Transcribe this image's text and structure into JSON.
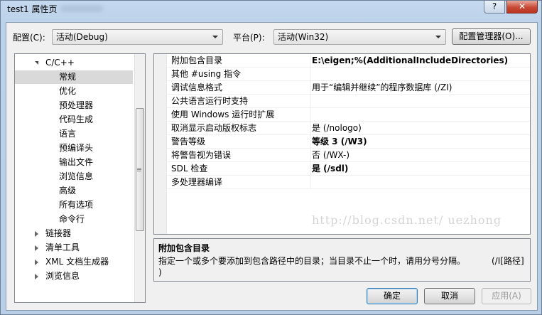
{
  "window": {
    "title": "test1 属性页",
    "help_label": "?",
    "close_label": "✕"
  },
  "toolbar": {
    "config_label": "配置(C):",
    "config_value": "活动(Debug)",
    "platform_label": "平台(P):",
    "platform_value": "活动(Win32)",
    "config_manager_label": "配置管理器(O)..."
  },
  "tree": {
    "items": [
      {
        "label": "C/C++",
        "level": 1,
        "expanded": true
      },
      {
        "label": "常规",
        "level": 2,
        "selected": true
      },
      {
        "label": "优化",
        "level": 2
      },
      {
        "label": "预处理器",
        "level": 2
      },
      {
        "label": "代码生成",
        "level": 2
      },
      {
        "label": "语言",
        "level": 2
      },
      {
        "label": "预编译头",
        "level": 2
      },
      {
        "label": "输出文件",
        "level": 2
      },
      {
        "label": "浏览信息",
        "level": 2
      },
      {
        "label": "高级",
        "level": 2
      },
      {
        "label": "所有选项",
        "level": 2
      },
      {
        "label": "命令行",
        "level": 2
      },
      {
        "label": "链接器",
        "level": 1,
        "expanded": false
      },
      {
        "label": "清单工具",
        "level": 1,
        "expanded": false
      },
      {
        "label": "XML 文档生成器",
        "level": 1,
        "expanded": false
      },
      {
        "label": "浏览信息",
        "level": 1,
        "expanded": false
      }
    ]
  },
  "properties": [
    {
      "name": "附加包含目录",
      "value": "E:\\eigen;%(AdditionalIncludeDirectories)",
      "bold": true
    },
    {
      "name": "其他 #using 指令",
      "value": "",
      "bold": false
    },
    {
      "name": "调试信息格式",
      "value": "用于“编辑并继续”的程序数据库 (/ZI)",
      "bold": false
    },
    {
      "name": "公共语言运行时支持",
      "value": "",
      "bold": false
    },
    {
      "name": "使用 Windows 运行时扩展",
      "value": "",
      "bold": false
    },
    {
      "name": "取消显示启动版权标志",
      "value": "是 (/nologo)",
      "bold": false
    },
    {
      "name": "警告等级",
      "value": "等级 3 (/W3)",
      "bold": true
    },
    {
      "name": "将警告视为错误",
      "value": "否 (/WX-)",
      "bold": false
    },
    {
      "name": "SDL 检查",
      "value": "是 (/sdl)",
      "bold": true
    },
    {
      "name": "多处理器编译",
      "value": "",
      "bold": false
    }
  ],
  "description": {
    "title": "附加包含目录",
    "text": "指定一个或多个要添加到包含路径中的目录；当目录不止一个时，请用分号分隔。",
    "switch": "(/I[路径]",
    "tail": ")"
  },
  "watermark": "http://blog.csdn.net/    uezhong",
  "buttons": {
    "ok": "确定",
    "cancel": "取消",
    "apply": "应用(A)"
  }
}
